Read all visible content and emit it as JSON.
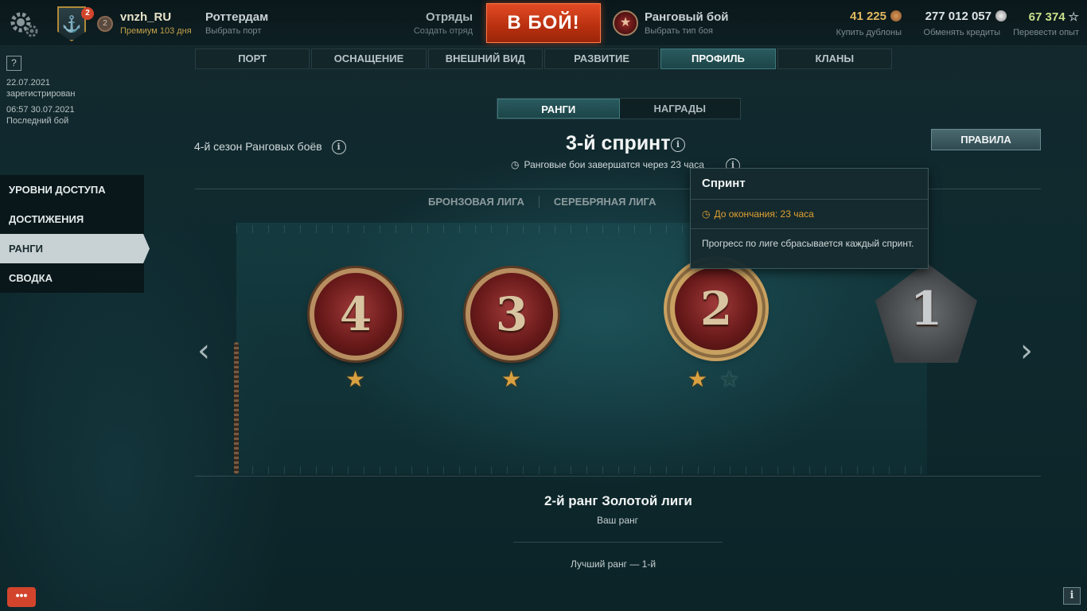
{
  "topbar": {
    "player": {
      "nickname": "vnzh_RU",
      "premium": "Премиум 103 дня",
      "notifications": "2",
      "level": "2"
    },
    "port": {
      "label": "Роттердам",
      "sub": "Выбрать порт"
    },
    "squads": {
      "label": "Отряды",
      "sub": "Создать отряд"
    },
    "battle_button": "В БОЙ!",
    "mode": {
      "label": "Ранговый бой",
      "sub": "Выбрать тип боя"
    },
    "currencies": [
      {
        "value": "41 225",
        "sub": "Купить дублоны",
        "color": "#e0b860"
      },
      {
        "value": "277 012 057",
        "sub": "Обменять кредиты",
        "color": "#dde3e4"
      },
      {
        "value": "67 374",
        "sub": "Перевести опыт",
        "color": "#c8e08a"
      }
    ]
  },
  "main_nav": {
    "tabs": [
      {
        "label": "ПОРТ"
      },
      {
        "label": "ОСНАЩЕНИЕ"
      },
      {
        "label": "ВНЕШНИЙ ВИД"
      },
      {
        "label": "РАЗВИТИЕ"
      },
      {
        "label": "ПРОФИЛЬ",
        "active": true
      },
      {
        "label": "КЛАНЫ"
      }
    ]
  },
  "sidebar": {
    "help": "?",
    "registered_date": "22.07.2021",
    "registered_label": "зарегистрирован",
    "last_battle_date": "06:57  30.07.2021",
    "last_battle_label": "Последний бой",
    "items": [
      {
        "label": "УРОВНИ ДОСТУПА"
      },
      {
        "label": "ДОСТИЖЕНИЯ"
      },
      {
        "label": "РАНГИ",
        "active": true
      },
      {
        "label": "СВОДКА"
      }
    ]
  },
  "content": {
    "subtabs": [
      {
        "label": "РАНГИ",
        "active": true
      },
      {
        "label": "НАГРАДЫ"
      }
    ],
    "season": "4-й сезон Ранговых боёв",
    "sprint_title": "3-й спринт",
    "timer": "Ранговые бои завершатся через 23 часа",
    "rules_button": "ПРАВИЛА",
    "leagues": [
      "БРОНЗОВАЯ ЛИГА",
      "СЕРЕБРЯНАЯ ЛИГА"
    ],
    "ranks": [
      {
        "number": "4",
        "stars_earned": 1,
        "stars_total": 1,
        "style": "bronze"
      },
      {
        "number": "3",
        "stars_earned": 1,
        "stars_total": 1,
        "style": "bronze"
      },
      {
        "number": "2",
        "stars_earned": 1,
        "stars_total": 2,
        "style": "gold"
      },
      {
        "number": "1",
        "stars_earned": 0,
        "stars_total": 0,
        "style": "silver"
      }
    ],
    "current_rank": "2-й ранг Золотой лиги",
    "current_rank_label": "Ваш ранг",
    "best_rank": "Лучший ранг — 1-й"
  },
  "tooltip": {
    "title": "Спринт",
    "remaining": "До окончания: 23 часа",
    "description": "Прогресс по лиге сбрасывается каждый спринт."
  },
  "footer": {
    "chat": "•••",
    "info": "i"
  }
}
